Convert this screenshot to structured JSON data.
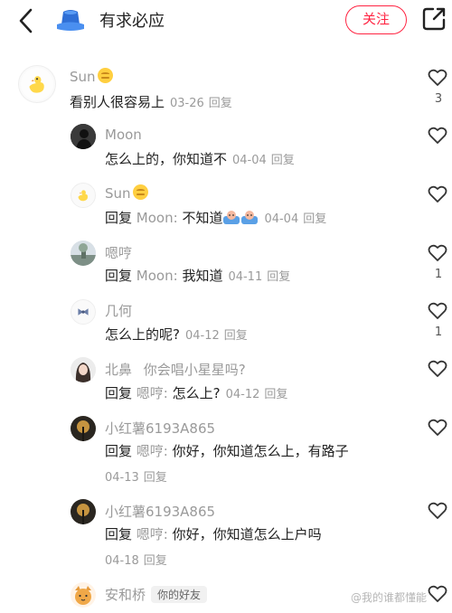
{
  "header": {
    "title": "有求必应",
    "follow_label": "关注"
  },
  "comments": [
    {
      "name": "Sun",
      "text": "看别人很容易上",
      "date": "03-26",
      "reply": "回复",
      "likes": "3"
    },
    {
      "name": "Moon",
      "text": "怎么上的，你知道不",
      "date": "04-04",
      "reply": "回复"
    },
    {
      "name": "Sun",
      "reply_prefix": "回复",
      "reply_target": "Moon:",
      "text": "不知道",
      "date": "04-04",
      "reply": "回复"
    },
    {
      "name": "嗯哼",
      "reply_prefix": "回复",
      "reply_target": "Moon:",
      "text": "我知道",
      "date": "04-11",
      "reply": "回复",
      "likes": "1"
    },
    {
      "name": "几何",
      "text": "怎么上的呢?",
      "date": "04-12",
      "reply": "回复",
      "likes": "1"
    },
    {
      "name": "北鼻",
      "name_suffix": "你会唱小星星吗?",
      "reply_prefix": "回复",
      "reply_target": "嗯哼:",
      "text": "怎么上?",
      "date": "04-12",
      "reply": "回复"
    },
    {
      "name": "小红薯6193A865",
      "reply_prefix": "回复",
      "reply_target": "嗯哼:",
      "text": "你好，你知道怎么上，有路子",
      "date": "04-13",
      "reply": "回复"
    },
    {
      "name": "小红薯6193A865",
      "reply_prefix": "回复",
      "reply_target": "嗯哼:",
      "text": "你好，你知道怎么上户吗",
      "date": "04-18",
      "reply": "回复"
    },
    {
      "name": "安和桥",
      "tag": "你的好友"
    }
  ],
  "watermark": "@我的谁都懂能",
  "colors": {
    "accent": "#ff2442",
    "muted": "#9a9a9a",
    "text": "#222222"
  },
  "icons": [
    "back-arrow-icon",
    "bucket-hat-icon",
    "share-icon",
    "heart-icon"
  ]
}
